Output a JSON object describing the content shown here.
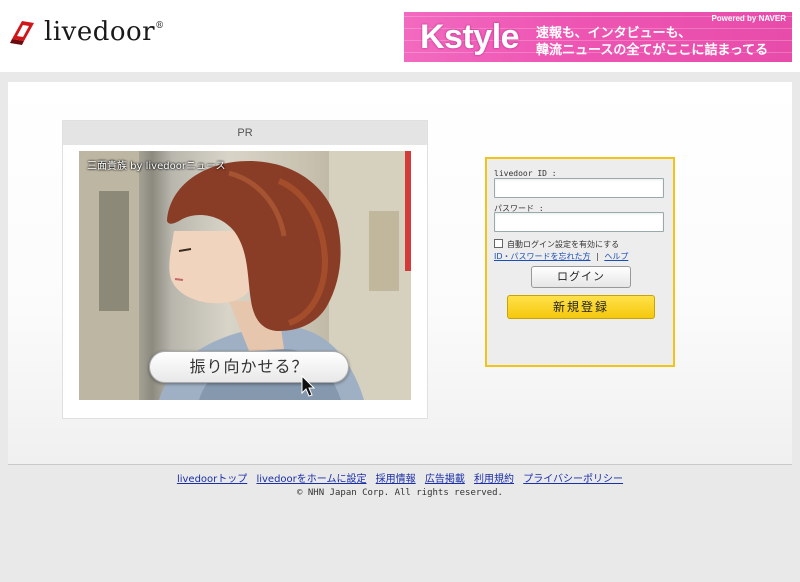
{
  "header": {
    "logo_text": "livedoor",
    "logo_reg": "®",
    "banner": {
      "brand": "Kstyle",
      "powered": "Powered by NAVER",
      "tagline_1": "速報も、インタビューも、",
      "tagline_2": "韓流ニュースの全てがここに詰まってる"
    }
  },
  "pr": {
    "heading": "PR",
    "caption": "三面貴族 by livedoorニュース",
    "cta": "振り向かせる？"
  },
  "login": {
    "id_label": "livedoor ID :",
    "id_value": "",
    "password_label": "パスワード :",
    "password_value": "",
    "remember_label": "自動ログイン設定を有効にする",
    "forgot_link": "ID・パスワードを忘れた方",
    "separator": "|",
    "help_link": "ヘルプ",
    "login_button": "ログイン",
    "register_button": "新規登録"
  },
  "footer": {
    "links": [
      "livedoorトップ",
      "livedoorをホームに設定",
      "採用情報",
      "広告掲載",
      "利用規約",
      "プライバシーポリシー"
    ],
    "copyright": "© NHN Japan Corp. All rights reserved."
  },
  "colors": {
    "banner_pink": "#ee56b4",
    "login_border": "#f0c419",
    "register_yellow": "#f5c80c",
    "link_blue": "#1a2fa8"
  }
}
